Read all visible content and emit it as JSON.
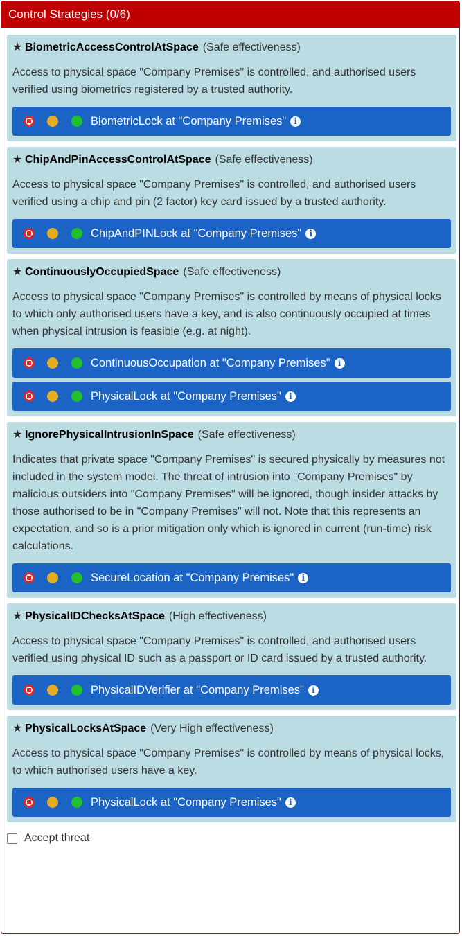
{
  "panel": {
    "title": "Control Strategies (0/6)"
  },
  "strategies": [
    {
      "name": "BiometricAccessControlAtSpace",
      "effectiveness": "(Safe effectiveness)",
      "description": "Access to physical space \"Company Premises\" is controlled, and authorised users verified using biometrics registered by a trusted authority.",
      "controls": [
        "BiometricLock at \"Company Premises\""
      ]
    },
    {
      "name": "ChipAndPinAccessControlAtSpace",
      "effectiveness": "(Safe effectiveness)",
      "description": "Access to physical space \"Company Premises\" is controlled, and authorised users verified using a chip and pin (2 factor) key card issued by a trusted authority.",
      "controls": [
        "ChipAndPINLock at \"Company Premises\""
      ]
    },
    {
      "name": "ContinuouslyOccupiedSpace",
      "effectiveness": "(Safe effectiveness)",
      "description": "Access to physical space \"Company Premises\" is controlled by means of physical locks to which only authorised users have a key, and is also continuously occupied at times when physical intrusion is feasible (e.g. at night).",
      "controls": [
        "ContinuousOccupation at \"Company Premises\"",
        "PhysicalLock at \"Company Premises\""
      ]
    },
    {
      "name": "IgnorePhysicalIntrusionInSpace",
      "effectiveness": "(Safe effectiveness)",
      "description": "Indicates that private space \"Company Premises\" is secured physically by measures not included in the system model. The threat of intrusion into \"Company Premises\" by malicious outsiders into \"Company Premises\" will be ignored, though insider attacks by those authorised to be in \"Company Premises\" will not. Note that this represents an expectation, and so is a prior mitigation only which is ignored in current (run-time) risk calculations.",
      "controls": [
        "SecureLocation at \"Company Premises\""
      ]
    },
    {
      "name": "PhysicalIDChecksAtSpace",
      "effectiveness": "(High effectiveness)",
      "description": "Access to physical space \"Company Premises\" is controlled, and authorised users verified using physical ID such as a passport or ID card issued by a trusted authority.",
      "controls": [
        "PhysicalIDVerifier at \"Company Premises\""
      ]
    },
    {
      "name": "PhysicalLocksAtSpace",
      "effectiveness": "(Very High effectiveness)",
      "description": "Access to physical space \"Company Premises\" is controlled by means of physical locks, to which authorised users have a key.",
      "controls": [
        "PhysicalLock at \"Company Premises\""
      ]
    }
  ],
  "accept_threat": {
    "label": "Accept threat",
    "checked": false
  },
  "icons": {
    "star": "star-icon",
    "stop": "stop-icon",
    "info": "info-icon"
  },
  "colors": {
    "header": "#c00000",
    "card": "#bcdce4",
    "control": "#1b63c5",
    "red": "#d42a2a",
    "amber": "#e4ad23",
    "green": "#22c02c"
  }
}
